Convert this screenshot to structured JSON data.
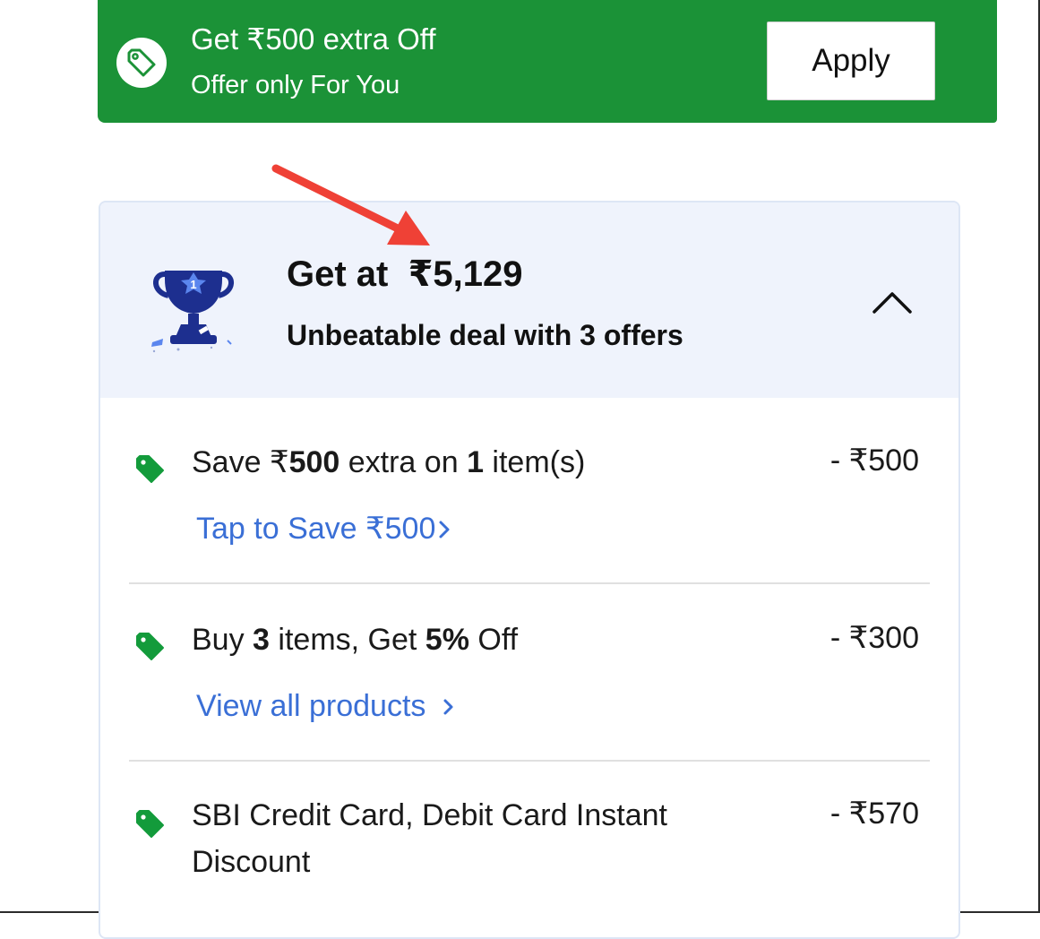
{
  "banner": {
    "title": "Get ₹500 extra Off",
    "subtitle": "Offer only For You",
    "apply_label": "Apply",
    "bg_color": "#1b9237",
    "icon": "tag-icon"
  },
  "deal": {
    "title": "Get at  ₹5,129",
    "subtitle": "Unbeatable deal with 3 offers",
    "icon": "trophy-icon",
    "badge_number": "1",
    "collapse_icon": "chevron-up-icon"
  },
  "offers": [
    {
      "text_parts": [
        "Save ₹",
        "500",
        " extra on ",
        "1",
        " item(s)"
      ],
      "amount": "- ₹500",
      "link": "Tap to Save ₹500",
      "link_icon": "chevron-right-icon"
    },
    {
      "text_parts": [
        "Buy ",
        "3",
        " items, Get ",
        "5%",
        " Off"
      ],
      "amount": "- ₹300",
      "link": "View all products",
      "link_icon": "chevron-right-icon"
    },
    {
      "text_line1": "SBI Credit Card, Debit Card Instant",
      "text_line2": "Discount",
      "amount": "- ₹570"
    }
  ],
  "colors": {
    "accent_green": "#1b9237",
    "link_blue": "#3a6fd6",
    "header_bg": "#eff3fc",
    "annotation_red": "#ef4136"
  }
}
